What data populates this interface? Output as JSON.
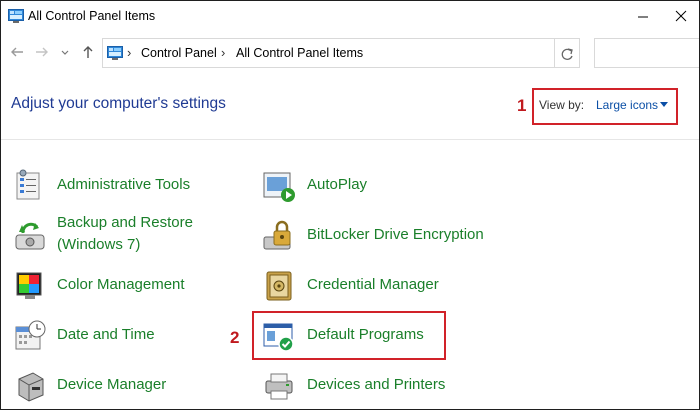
{
  "window": {
    "title": "All Control Panel Items"
  },
  "address_bar": {
    "crumbs": [
      "Control Panel",
      "All Control Panel Items"
    ]
  },
  "header": {
    "heading": "Adjust your computer's settings",
    "view_by_label": "View by:",
    "view_by_value": "Large icons"
  },
  "annotations": {
    "step1": "1",
    "step2": "2"
  },
  "items": {
    "administrative_tools": "Administrative Tools",
    "autoplay": "AutoPlay",
    "backup_restore_line1": "Backup and Restore",
    "backup_restore_line2": "(Windows 7)",
    "bitlocker": "BitLocker Drive Encryption",
    "color_management": "Color Management",
    "credential_manager": "Credential Manager",
    "date_time": "Date and Time",
    "default_programs": "Default Programs",
    "device_manager": "Device Manager",
    "devices_printers": "Devices and Printers"
  },
  "colors": {
    "link_green": "#1a7f2a",
    "heading_blue": "#1f3a93",
    "annotation_red": "#d12229"
  }
}
